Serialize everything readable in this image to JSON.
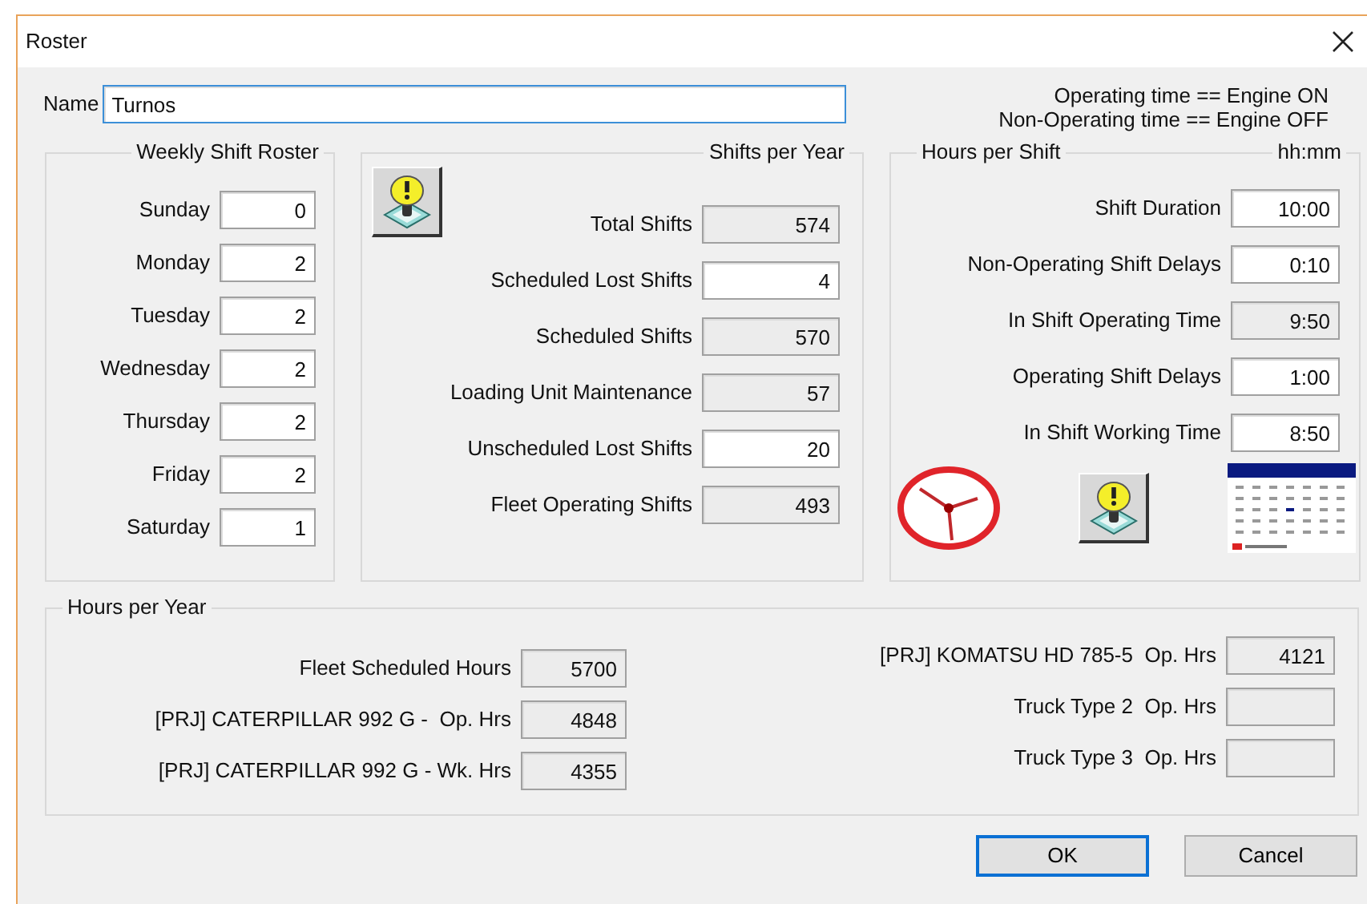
{
  "window": {
    "title": "Roster"
  },
  "name_field": {
    "label": "Name",
    "value": "Turnos",
    "focused": true
  },
  "notes": [
    "Operating time == Engine ON",
    "Non-Operating time == Engine OFF"
  ],
  "weekly_roster": {
    "title": "Weekly Shift Roster",
    "rows": [
      {
        "label": "Sunday",
        "value": "0",
        "readonly": false
      },
      {
        "label": "Monday",
        "value": "2",
        "readonly": false
      },
      {
        "label": "Tuesday",
        "value": "2",
        "readonly": false
      },
      {
        "label": "Wednesday",
        "value": "2",
        "readonly": false
      },
      {
        "label": "Thursday",
        "value": "2",
        "readonly": false
      },
      {
        "label": "Friday",
        "value": "2",
        "readonly": false
      },
      {
        "label": "Saturday",
        "value": "1",
        "readonly": false
      }
    ]
  },
  "shifts_per_year": {
    "title": "Shifts per Year",
    "rows": [
      {
        "label": "Total Shifts",
        "value": "574",
        "readonly": true
      },
      {
        "label": "Scheduled Lost Shifts",
        "value": "4",
        "readonly": false
      },
      {
        "label": "Scheduled Shifts",
        "value": "570",
        "readonly": true
      },
      {
        "label": "Loading Unit Maintenance",
        "value": "57",
        "readonly": true
      },
      {
        "label": "Unscheduled Lost Shifts",
        "value": "20",
        "readonly": false
      },
      {
        "label": "Fleet Operating Shifts",
        "value": "493",
        "readonly": true
      }
    ]
  },
  "hours_per_shift": {
    "title": "Hours per Shift",
    "unit": "hh:mm",
    "rows": [
      {
        "label": "Shift Duration",
        "value": "10:00",
        "readonly": false
      },
      {
        "label": "Non-Operating Shift Delays",
        "value": "0:10",
        "readonly": false
      },
      {
        "label": "In Shift Operating Time",
        "value": "9:50",
        "readonly": true
      },
      {
        "label": "Operating Shift Delays",
        "value": "1:00",
        "readonly": false
      },
      {
        "label": "In Shift Working Time",
        "value": "8:50",
        "readonly": false
      }
    ]
  },
  "hours_per_year": {
    "title": "Hours per Year",
    "left_rows": [
      {
        "label": "Fleet Scheduled Hours",
        "value": "5700",
        "readonly": true
      },
      {
        "label": "[PRJ] CATERPILLAR 992 G -  Op. Hrs",
        "value": "4848",
        "readonly": true
      },
      {
        "label": "[PRJ] CATERPILLAR 992 G - Wk. Hrs",
        "value": "4355",
        "readonly": true
      }
    ],
    "right_rows": [
      {
        "label": "[PRJ] KOMATSU HD 785-5  Op. Hrs",
        "value": "4121",
        "readonly": true
      },
      {
        "label": "Truck Type 2  Op. Hrs",
        "readonly": true
      },
      {
        "label": "Truck Type 3  Op. Hrs",
        "readonly": true
      }
    ]
  },
  "buttons": [
    {
      "label": "OK",
      "default": true
    },
    {
      "label": "Cancel",
      "default": false
    }
  ]
}
